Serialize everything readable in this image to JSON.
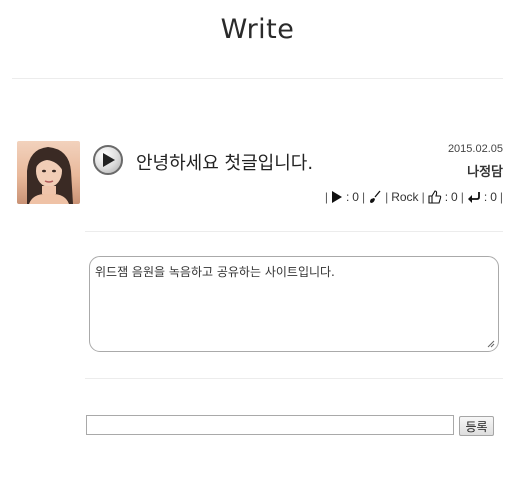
{
  "page": {
    "title": "Write"
  },
  "post": {
    "title": "안녕하세요 첫글입니다.",
    "date": "2015.02.05",
    "author": "나정담",
    "stats": {
      "plays": "0",
      "genre": "Rock",
      "likes": "0",
      "replies": "0"
    },
    "content": "위드잼 음원을 녹음하고 공유하는 사이트입니다."
  },
  "comment": {
    "input_value": "",
    "submit_label": "등록"
  }
}
